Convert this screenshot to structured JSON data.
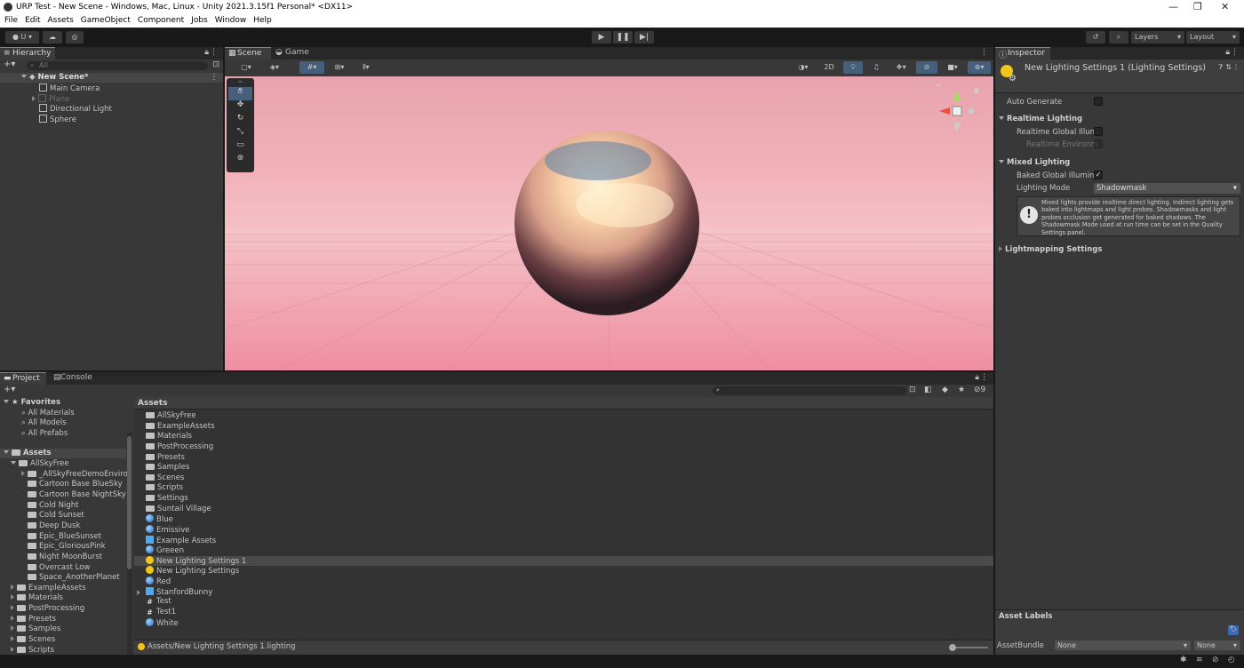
{
  "window": {
    "title": "URP Test - New Scene - Windows, Mac, Linux - Unity 2021.3.15f1 Personal* <DX11>"
  },
  "menu": [
    "File",
    "Edit",
    "Assets",
    "GameObject",
    "Component",
    "Jobs",
    "Window",
    "Help"
  ],
  "toolbar": {
    "account_label": "U",
    "layers_label": "Layers",
    "layout_label": "Layout"
  },
  "hierarchy": {
    "tab_label": "Hierarchy",
    "search_placeholder": "All",
    "scene_name": "New Scene*",
    "items": [
      "Main Camera",
      "Plane",
      "Directional Light",
      "Sphere"
    ]
  },
  "scene_view": {
    "tabs": [
      "Scene",
      "Game"
    ],
    "mode_2d": "2D"
  },
  "inspector": {
    "tab_label": "Inspector",
    "asset_title": "New Lighting Settings 1 (Lighting Settings)",
    "auto_generate_label": "Auto Generate",
    "realtime_section": "Realtime Lighting",
    "realtime_gi_label": "Realtime Global Illum",
    "realtime_env_label": "Realtime Environm",
    "mixed_section": "Mixed Lighting",
    "baked_gi_label": "Baked Global Illumina",
    "baked_gi_checked": "✓",
    "lighting_mode_label": "Lighting Mode",
    "lighting_mode_value": "Shadowmask",
    "help_text": "Mixed lights provide realtime direct lighting. Indirect lighting gets baked into lightmaps and light probes. Shadowmasks and light probes occlusion get generated for baked shadows. The Shadowmask Mode used at run time can be set in the Quality Settings panel.",
    "lightmapping_section": "Lightmapping Settings",
    "asset_labels": "Asset Labels",
    "asset_bundle_label": "AssetBundle",
    "asset_bundle_value": "None",
    "asset_variant_value": "None"
  },
  "project": {
    "tabs": [
      "Project",
      "Console"
    ],
    "favorites_label": "Favorites",
    "favorites": [
      "All Materials",
      "All Models",
      "All Prefabs"
    ],
    "assets_label": "Assets",
    "tree": [
      {
        "label": "AllSkyFree",
        "indent": 1,
        "open": true
      },
      {
        "label": "_AllSkyFreeDemoEnviro",
        "indent": 2
      },
      {
        "label": "Cartoon Base BlueSky",
        "indent": 2
      },
      {
        "label": "Cartoon Base NightSky",
        "indent": 2
      },
      {
        "label": "Cold Night",
        "indent": 2
      },
      {
        "label": "Cold Sunset",
        "indent": 2
      },
      {
        "label": "Deep Dusk",
        "indent": 2
      },
      {
        "label": "Epic_BlueSunset",
        "indent": 2
      },
      {
        "label": "Epic_GloriousPink",
        "indent": 2
      },
      {
        "label": "Night MoonBurst",
        "indent": 2
      },
      {
        "label": "Overcast Low",
        "indent": 2
      },
      {
        "label": "Space_AnotherPlanet",
        "indent": 2
      },
      {
        "label": "ExampleAssets",
        "indent": 1
      },
      {
        "label": "Materials",
        "indent": 1
      },
      {
        "label": "PostProcessing",
        "indent": 1
      },
      {
        "label": "Presets",
        "indent": 1
      },
      {
        "label": "Samples",
        "indent": 1
      },
      {
        "label": "Scenes",
        "indent": 1
      },
      {
        "label": "Scripts",
        "indent": 1
      }
    ],
    "grid_header": "Assets",
    "files": [
      {
        "label": "AllSkyFree",
        "icon": "folder"
      },
      {
        "label": "ExampleAssets",
        "icon": "folder"
      },
      {
        "label": "Materials",
        "icon": "folder"
      },
      {
        "label": "PostProcessing",
        "icon": "folder"
      },
      {
        "label": "Presets",
        "icon": "folder"
      },
      {
        "label": "Samples",
        "icon": "folder"
      },
      {
        "label": "Scenes",
        "icon": "folder"
      },
      {
        "label": "Scripts",
        "icon": "folder"
      },
      {
        "label": "Settings",
        "icon": "folder"
      },
      {
        "label": "Suntail Village",
        "icon": "folder"
      },
      {
        "label": "Blue",
        "icon": "sphere"
      },
      {
        "label": "Emissive",
        "icon": "sphere"
      },
      {
        "label": "Example Assets",
        "icon": "cube"
      },
      {
        "label": "Greeen",
        "icon": "sphere"
      },
      {
        "label": "New Lighting Settings 1",
        "icon": "bulb"
      },
      {
        "label": "New Lighting Settings",
        "icon": "bulb"
      },
      {
        "label": "Red",
        "icon": "sphere"
      },
      {
        "label": "StanfordBunny",
        "icon": "cube"
      },
      {
        "label": "Test",
        "icon": "hash"
      },
      {
        "label": "Test1",
        "icon": "hash"
      },
      {
        "label": "White",
        "icon": "sphere"
      }
    ],
    "selected_file": "New Lighting Settings 1",
    "status_path": "Assets/New Lighting Settings 1.lighting",
    "hidden_count": "9"
  },
  "colors": {
    "accent": "#4d8cff",
    "sky_top": "#f0a3ad",
    "sky_bottom": "#f6b6be"
  }
}
